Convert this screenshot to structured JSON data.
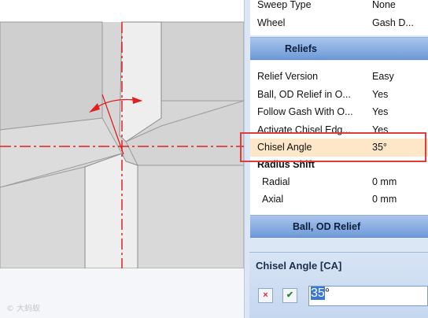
{
  "viewport": {
    "watermark": "© 大蚂蚁"
  },
  "panel": {
    "top_rows": [
      {
        "name": "Sweep Type",
        "value": "None"
      },
      {
        "name": "Wheel",
        "value": "Gash D..."
      }
    ],
    "reliefs_header": "Reliefs",
    "relief_rows": [
      {
        "name": "Relief Version",
        "value": "Easy"
      },
      {
        "name": "Ball, OD Relief in O...",
        "value": "Yes"
      },
      {
        "name": "Follow Gash With O...",
        "value": "Yes"
      },
      {
        "name": "Activate Chisel Edg...",
        "value": "Yes"
      },
      {
        "name": "Chisel Angle",
        "value": "35°"
      }
    ],
    "radius_shift_label": "Radius Shift",
    "radius_rows": [
      {
        "name": "Radial",
        "value": "0 mm"
      },
      {
        "name": "Axial",
        "value": "0 mm"
      }
    ],
    "ball_header": "Ball, OD Relief"
  },
  "editor": {
    "title": "Chisel Angle [CA]",
    "cancel_icon": "×",
    "ok_icon": "✔",
    "value_number": "35",
    "value_unit": "°"
  },
  "colors": {
    "highlight": "#e03c3c",
    "centerline": "#e02020",
    "section_bar": "#6f9ad8"
  }
}
